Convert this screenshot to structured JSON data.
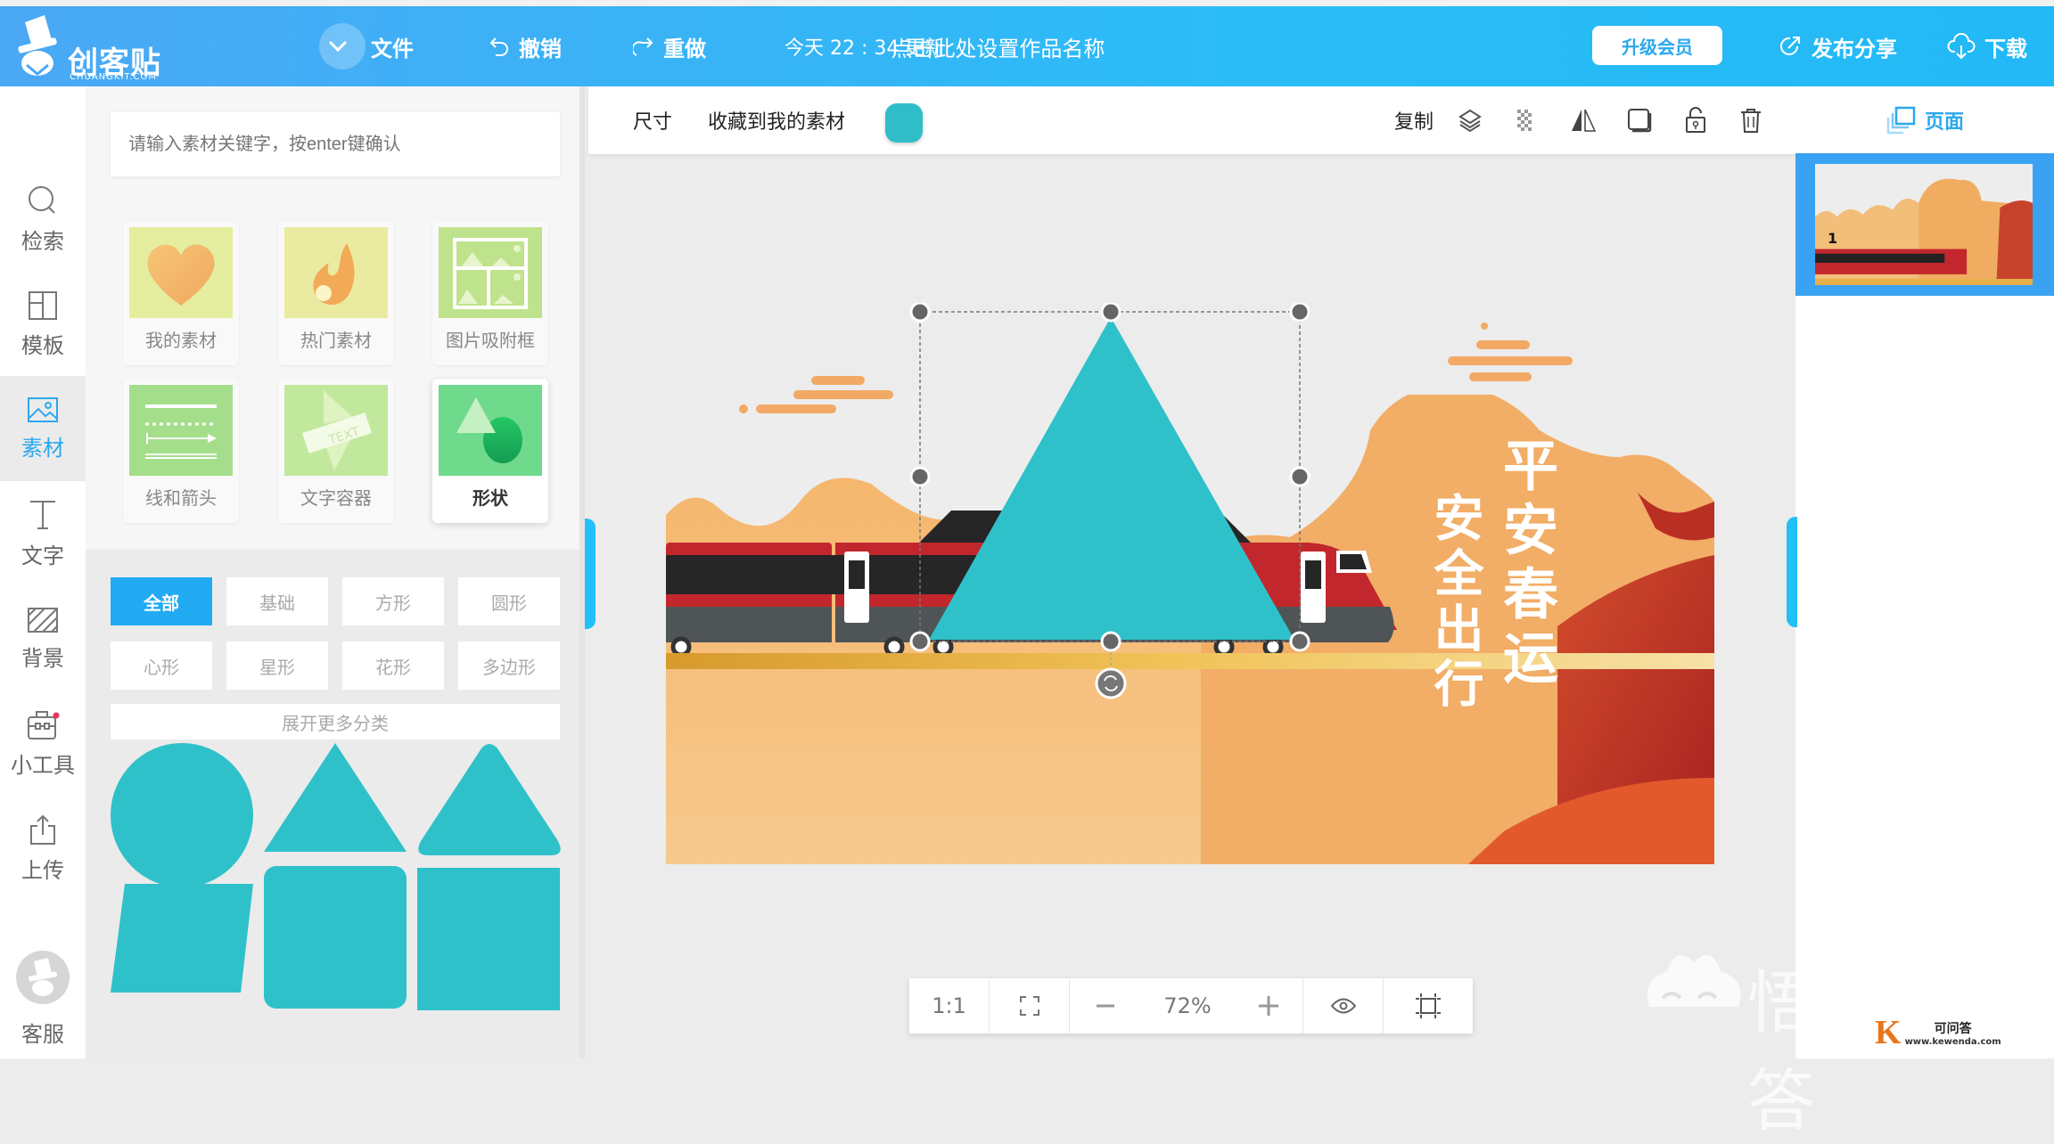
{
  "header": {
    "logo_name": "创客贴",
    "logo_domain": "CHUANGKIT.COM",
    "file_label": "文件",
    "undo_label": "撤销",
    "redo_label": "重做",
    "saved_time": "今天 22 : 34 更新",
    "doc_name_placeholder": "点击此处设置作品名称",
    "upgrade_label": "升级会员",
    "publish_label": "发布分享",
    "download_label": "下载"
  },
  "leftnav": {
    "items": [
      {
        "label": "检索",
        "icon": "search-icon"
      },
      {
        "label": "模板",
        "icon": "template-icon"
      },
      {
        "label": "素材",
        "icon": "image-icon",
        "active": true
      },
      {
        "label": "文字",
        "icon": "text-icon"
      },
      {
        "label": "背景",
        "icon": "background-icon"
      },
      {
        "label": "小工具",
        "icon": "toolbox-icon"
      },
      {
        "label": "上传",
        "icon": "upload-icon"
      }
    ],
    "support_label": "客服"
  },
  "panel": {
    "search_placeholder": "请输入素材关键字，按enter键确认",
    "categories": [
      {
        "label": "我的素材"
      },
      {
        "label": "热门素材"
      },
      {
        "label": "图片吸附框"
      },
      {
        "label": "线和箭头"
      },
      {
        "label": "文字容器"
      },
      {
        "label": "形状",
        "active": true
      }
    ],
    "filters": [
      {
        "label": "全部",
        "active": true
      },
      {
        "label": "基础"
      },
      {
        "label": "方形"
      },
      {
        "label": "圆形"
      },
      {
        "label": "心形"
      },
      {
        "label": "星形"
      },
      {
        "label": "花形"
      },
      {
        "label": "多边形"
      }
    ],
    "expand_label": "展开更多分类",
    "shape_color": "#2fc1c9",
    "shapes": [
      "circle",
      "triangle",
      "rounded-triangle",
      "parallelogram",
      "rounded-square",
      "square"
    ]
  },
  "toolbar": {
    "size_label": "尺寸",
    "favorite_label": "收藏到我的素材",
    "fill_color": "#2fbec8",
    "copy_label": "复制"
  },
  "canvas": {
    "selected_shape": "triangle",
    "selected_color": "#2fc1c9",
    "poster_text_right": "平安春运",
    "poster_text_left": "安全出行"
  },
  "rightpanel": {
    "pages_label": "页面",
    "page_number": "1"
  },
  "zoombar": {
    "actual_size_label": "1:1",
    "zoom_value": "72%"
  },
  "watermark": {
    "text": "悟空问答",
    "badge_title": "可问答",
    "badge_url": "www.kewenda.com"
  }
}
